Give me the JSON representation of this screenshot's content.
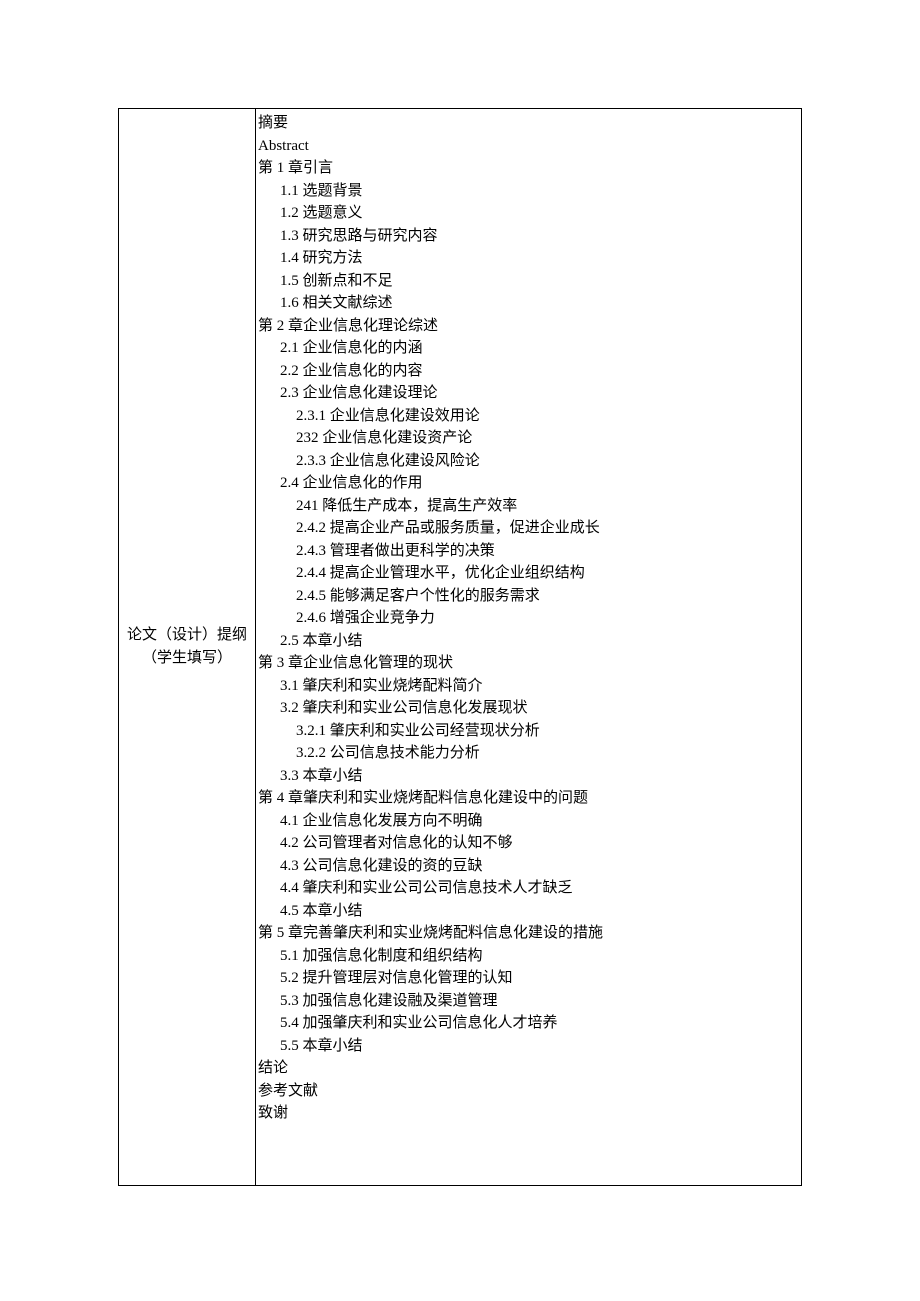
{
  "label": {
    "line1": "论文（设计）提纲",
    "line2": "（学生填写）"
  },
  "outline": [
    {
      "level": 0,
      "text": "摘要"
    },
    {
      "level": 0,
      "text": "Abstract"
    },
    {
      "level": 0,
      "text": "第 1 章引言"
    },
    {
      "level": 1,
      "text": "1.1  选题背景"
    },
    {
      "level": 1,
      "text": "1.2  选题意义"
    },
    {
      "level": 1,
      "text": "1.3  研究思路与研究内容"
    },
    {
      "level": 1,
      "text": "1.4  研究方法"
    },
    {
      "level": 1,
      "text": "1.5  创新点和不足"
    },
    {
      "level": 1,
      "text": "1.6  相关文献综述"
    },
    {
      "level": 0,
      "text": "第 2 章企业信息化理论综述"
    },
    {
      "level": 1,
      "text": "2.1  企业信息化的内涵"
    },
    {
      "level": 1,
      "text": "2.2  企业信息化的内容"
    },
    {
      "level": 1,
      "text": "2.3  企业信息化建设理论"
    },
    {
      "level": 2,
      "text": "2.3.1 企业信息化建设效用论"
    },
    {
      "level": 2,
      "text": "232 企业信息化建设资产论"
    },
    {
      "level": 2,
      "text": "2.3.3 企业信息化建设风险论"
    },
    {
      "level": 1,
      "text": "2.4  企业信息化的作用"
    },
    {
      "level": 2,
      "text": "241 降低生产成本，提高生产效率"
    },
    {
      "level": 2,
      "text": "2.4.2 提高企业产品或服务质量，促进企业成长"
    },
    {
      "level": 2,
      "text": "2.4.3 管理者做出更科学的决策"
    },
    {
      "level": 2,
      "text": "2.4.4 提高企业管理水平，优化企业组织结构"
    },
    {
      "level": 2,
      "text": "2.4.5 能够满足客户个性化的服务需求"
    },
    {
      "level": 2,
      "text": "2.4.6 增强企业竞争力"
    },
    {
      "level": 1,
      "text": "2.5  本章小结"
    },
    {
      "level": 0,
      "text": "第 3 章企业信息化管理的现状"
    },
    {
      "level": 1,
      "text": "3.1  肇庆利和实业烧烤配料简介"
    },
    {
      "level": 1,
      "text": "3.2  肇庆利和实业公司信息化发展现状"
    },
    {
      "level": 2,
      "text": "3.2.1  肇庆利和实业公司经营现状分析"
    },
    {
      "level": 2,
      "text": "3.2.2  公司信息技术能力分析"
    },
    {
      "level": 1,
      "text": "3.3  本章小结"
    },
    {
      "level": 0,
      "text": "第 4 章肇庆利和实业烧烤配料信息化建设中的问题"
    },
    {
      "level": 1,
      "text": "4.1  企业信息化发展方向不明确"
    },
    {
      "level": 1,
      "text": "4.2  公司管理者对信息化的认知不够"
    },
    {
      "level": 1,
      "text": "4.3  公司信息化建设的资的豆缺"
    },
    {
      "level": 1,
      "text": "4.4  肇庆利和实业公司公司信息技术人才缺乏"
    },
    {
      "level": 1,
      "text": "4.5  本章小结"
    },
    {
      "level": 0,
      "text": "第 5 章完善肇庆利和实业烧烤配料信息化建设的措施"
    },
    {
      "level": 1,
      "text": "5.1  加强信息化制度和组织结构"
    },
    {
      "level": 1,
      "text": "5.2  提升管理层对信息化管理的认知"
    },
    {
      "level": 1,
      "text": "5.3  加强信息化建设融及渠道管理"
    },
    {
      "level": 1,
      "text": "5.4  加强肇庆利和实业公司信息化人才培养"
    },
    {
      "level": 1,
      "text": "5.5  本章小结"
    },
    {
      "level": 0,
      "text": "结论"
    },
    {
      "level": 0,
      "text": "参考文献"
    },
    {
      "level": 0,
      "text": "致谢"
    }
  ]
}
